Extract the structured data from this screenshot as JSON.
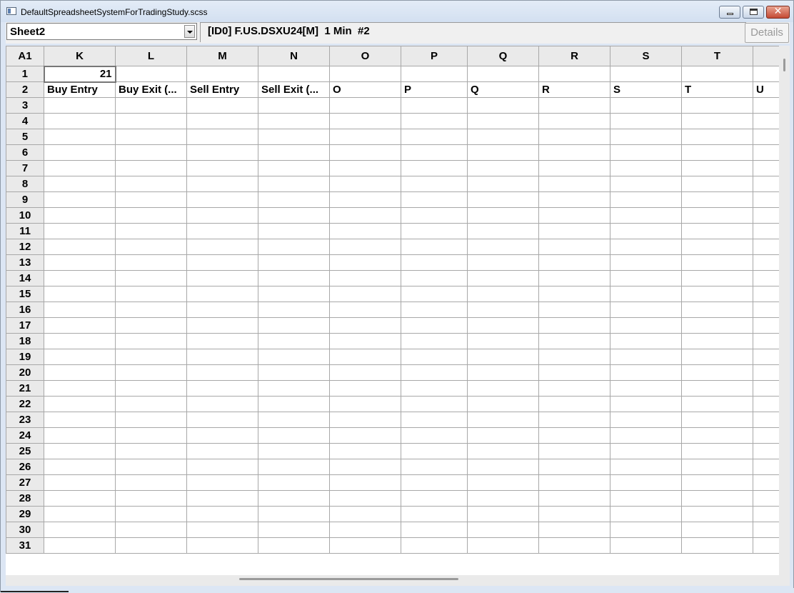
{
  "window": {
    "title": "DefaultSpreadsheetSystemForTradingStudy.scss"
  },
  "toolbar": {
    "sheet_selected": "Sheet2",
    "symbol_info": "[ID0] F.US.DSXU24[M]  1 Min  #2",
    "details_label": "Details"
  },
  "grid": {
    "corner": "A1",
    "columns": [
      "K",
      "L",
      "M",
      "N",
      "O",
      "P",
      "Q",
      "R",
      "S",
      "T",
      ""
    ],
    "rows": [
      {
        "num": "1",
        "cells": [
          "21",
          "",
          "",
          "",
          "",
          "",
          "",
          "",
          "",
          "",
          ""
        ]
      },
      {
        "num": "2",
        "cells": [
          "Buy Entry",
          "Buy Exit (...",
          "Sell Entry",
          "Sell Exit (...",
          "O",
          "P",
          "Q",
          "R",
          "S",
          "T",
          "U"
        ]
      },
      {
        "num": "3",
        "cells": [
          "",
          "",
          "",
          "",
          "",
          "",
          "",
          "",
          "",
          "",
          ""
        ]
      },
      {
        "num": "4",
        "cells": [
          "",
          "",
          "",
          "",
          "",
          "",
          "",
          "",
          "",
          "",
          ""
        ]
      },
      {
        "num": "5",
        "cells": [
          "",
          "",
          "",
          "",
          "",
          "",
          "",
          "",
          "",
          "",
          ""
        ]
      },
      {
        "num": "6",
        "cells": [
          "",
          "",
          "",
          "",
          "",
          "",
          "",
          "",
          "",
          "",
          ""
        ]
      },
      {
        "num": "7",
        "cells": [
          "",
          "",
          "",
          "",
          "",
          "",
          "",
          "",
          "",
          "",
          ""
        ]
      },
      {
        "num": "8",
        "cells": [
          "",
          "",
          "",
          "",
          "",
          "",
          "",
          "",
          "",
          "",
          ""
        ]
      },
      {
        "num": "9",
        "cells": [
          "",
          "",
          "",
          "",
          "",
          "",
          "",
          "",
          "",
          "",
          ""
        ]
      },
      {
        "num": "10",
        "cells": [
          "",
          "",
          "",
          "",
          "",
          "",
          "",
          "",
          "",
          "",
          ""
        ]
      },
      {
        "num": "11",
        "cells": [
          "",
          "",
          "",
          "",
          "",
          "",
          "",
          "",
          "",
          "",
          ""
        ]
      },
      {
        "num": "12",
        "cells": [
          "",
          "",
          "",
          "",
          "",
          "",
          "",
          "",
          "",
          "",
          ""
        ]
      },
      {
        "num": "13",
        "cells": [
          "",
          "",
          "",
          "",
          "",
          "",
          "",
          "",
          "",
          "",
          ""
        ]
      },
      {
        "num": "14",
        "cells": [
          "",
          "",
          "",
          "",
          "",
          "",
          "",
          "",
          "",
          "",
          ""
        ]
      },
      {
        "num": "15",
        "cells": [
          "",
          "",
          "",
          "",
          "",
          "",
          "",
          "",
          "",
          "",
          ""
        ]
      },
      {
        "num": "16",
        "cells": [
          "",
          "",
          "",
          "",
          "",
          "",
          "",
          "",
          "",
          "",
          ""
        ]
      },
      {
        "num": "17",
        "cells": [
          "",
          "",
          "",
          "",
          "",
          "",
          "",
          "",
          "",
          "",
          ""
        ]
      },
      {
        "num": "18",
        "cells": [
          "",
          "",
          "",
          "",
          "",
          "",
          "",
          "",
          "",
          "",
          ""
        ]
      },
      {
        "num": "19",
        "cells": [
          "",
          "",
          "",
          "",
          "",
          "",
          "",
          "",
          "",
          "",
          ""
        ]
      },
      {
        "num": "20",
        "cells": [
          "",
          "",
          "",
          "",
          "",
          "",
          "",
          "",
          "",
          "",
          ""
        ]
      },
      {
        "num": "21",
        "cells": [
          "",
          "",
          "",
          "",
          "",
          "",
          "",
          "",
          "",
          "",
          ""
        ]
      },
      {
        "num": "22",
        "cells": [
          "",
          "",
          "",
          "",
          "",
          "",
          "",
          "",
          "",
          "",
          ""
        ]
      },
      {
        "num": "23",
        "cells": [
          "",
          "",
          "",
          "",
          "",
          "",
          "",
          "",
          "",
          "",
          ""
        ]
      },
      {
        "num": "24",
        "cells": [
          "",
          "",
          "",
          "",
          "",
          "",
          "",
          "",
          "",
          "",
          ""
        ]
      },
      {
        "num": "25",
        "cells": [
          "",
          "",
          "",
          "",
          "",
          "",
          "",
          "",
          "",
          "",
          ""
        ]
      },
      {
        "num": "26",
        "cells": [
          "",
          "",
          "",
          "",
          "",
          "",
          "",
          "",
          "",
          "",
          ""
        ]
      },
      {
        "num": "27",
        "cells": [
          "",
          "",
          "",
          "",
          "",
          "",
          "",
          "",
          "",
          "",
          ""
        ]
      },
      {
        "num": "28",
        "cells": [
          "",
          "",
          "",
          "",
          "",
          "",
          "",
          "",
          "",
          "",
          ""
        ]
      },
      {
        "num": "29",
        "cells": [
          "",
          "",
          "",
          "",
          "",
          "",
          "",
          "",
          "",
          "",
          ""
        ]
      },
      {
        "num": "30",
        "cells": [
          "",
          "",
          "",
          "",
          "",
          "",
          "",
          "",
          "",
          "",
          ""
        ]
      },
      {
        "num": "31",
        "cells": [
          "",
          "",
          "",
          "",
          "",
          "",
          "",
          "",
          "",
          "",
          ""
        ]
      }
    ]
  },
  "icons": {
    "app": "spreadsheet-window-icon",
    "minimize": "minimize-icon",
    "maximize": "maximize-icon",
    "close": "close-icon",
    "dropdown": "chevron-down-icon"
  },
  "colors": {
    "close_button": "#c44a33",
    "header_bg": "#eaeaea",
    "grid_line": "#a8a8a8",
    "window_frame": "#dce6f4"
  }
}
